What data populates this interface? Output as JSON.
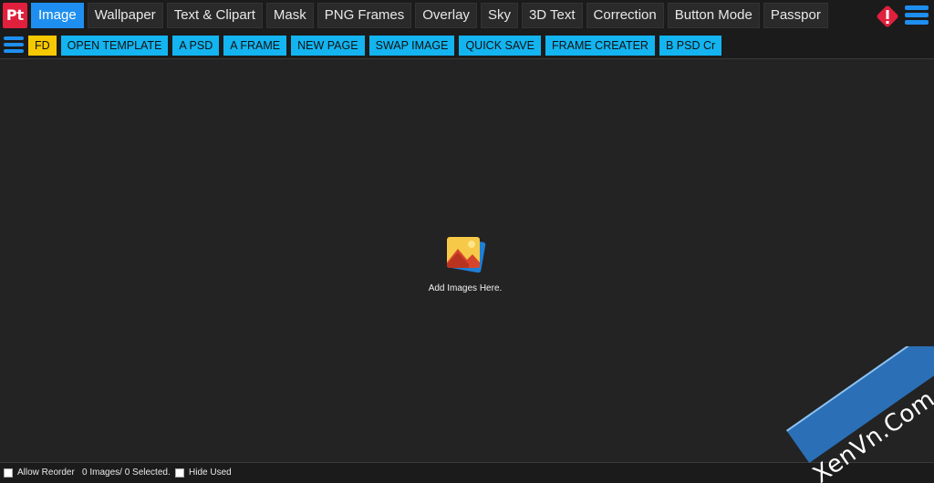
{
  "app": {
    "logo_text": "Pt"
  },
  "tabs": [
    {
      "label": "Image",
      "active": true
    },
    {
      "label": "Wallpaper"
    },
    {
      "label": "Text & Clipart"
    },
    {
      "label": "Mask"
    },
    {
      "label": "PNG Frames"
    },
    {
      "label": "Overlay"
    },
    {
      "label": "Sky"
    },
    {
      "label": "3D Text"
    },
    {
      "label": "Correction"
    },
    {
      "label": "Button Mode"
    },
    {
      "label": "Passpor"
    }
  ],
  "toolbar": {
    "buttons": [
      "FD",
      "OPEN TEMPLATE",
      "A PSD",
      "A FRAME",
      "NEW PAGE",
      "SWAP IMAGE",
      "QUICK SAVE",
      "FRAME CREATER",
      "B PSD Cr"
    ]
  },
  "canvas": {
    "empty_text": "Add Images Here."
  },
  "status": {
    "allow_reorder": "Allow Reorder",
    "count_text": "0 Images/ 0 Selected.",
    "hide_used": "Hide Used"
  },
  "watermark": {
    "text": "XenVn.Com"
  },
  "colors": {
    "accent": "#1e8ff0",
    "button": "#13b4f0",
    "fd_button": "#f5c800",
    "logo": "#e0203d"
  }
}
